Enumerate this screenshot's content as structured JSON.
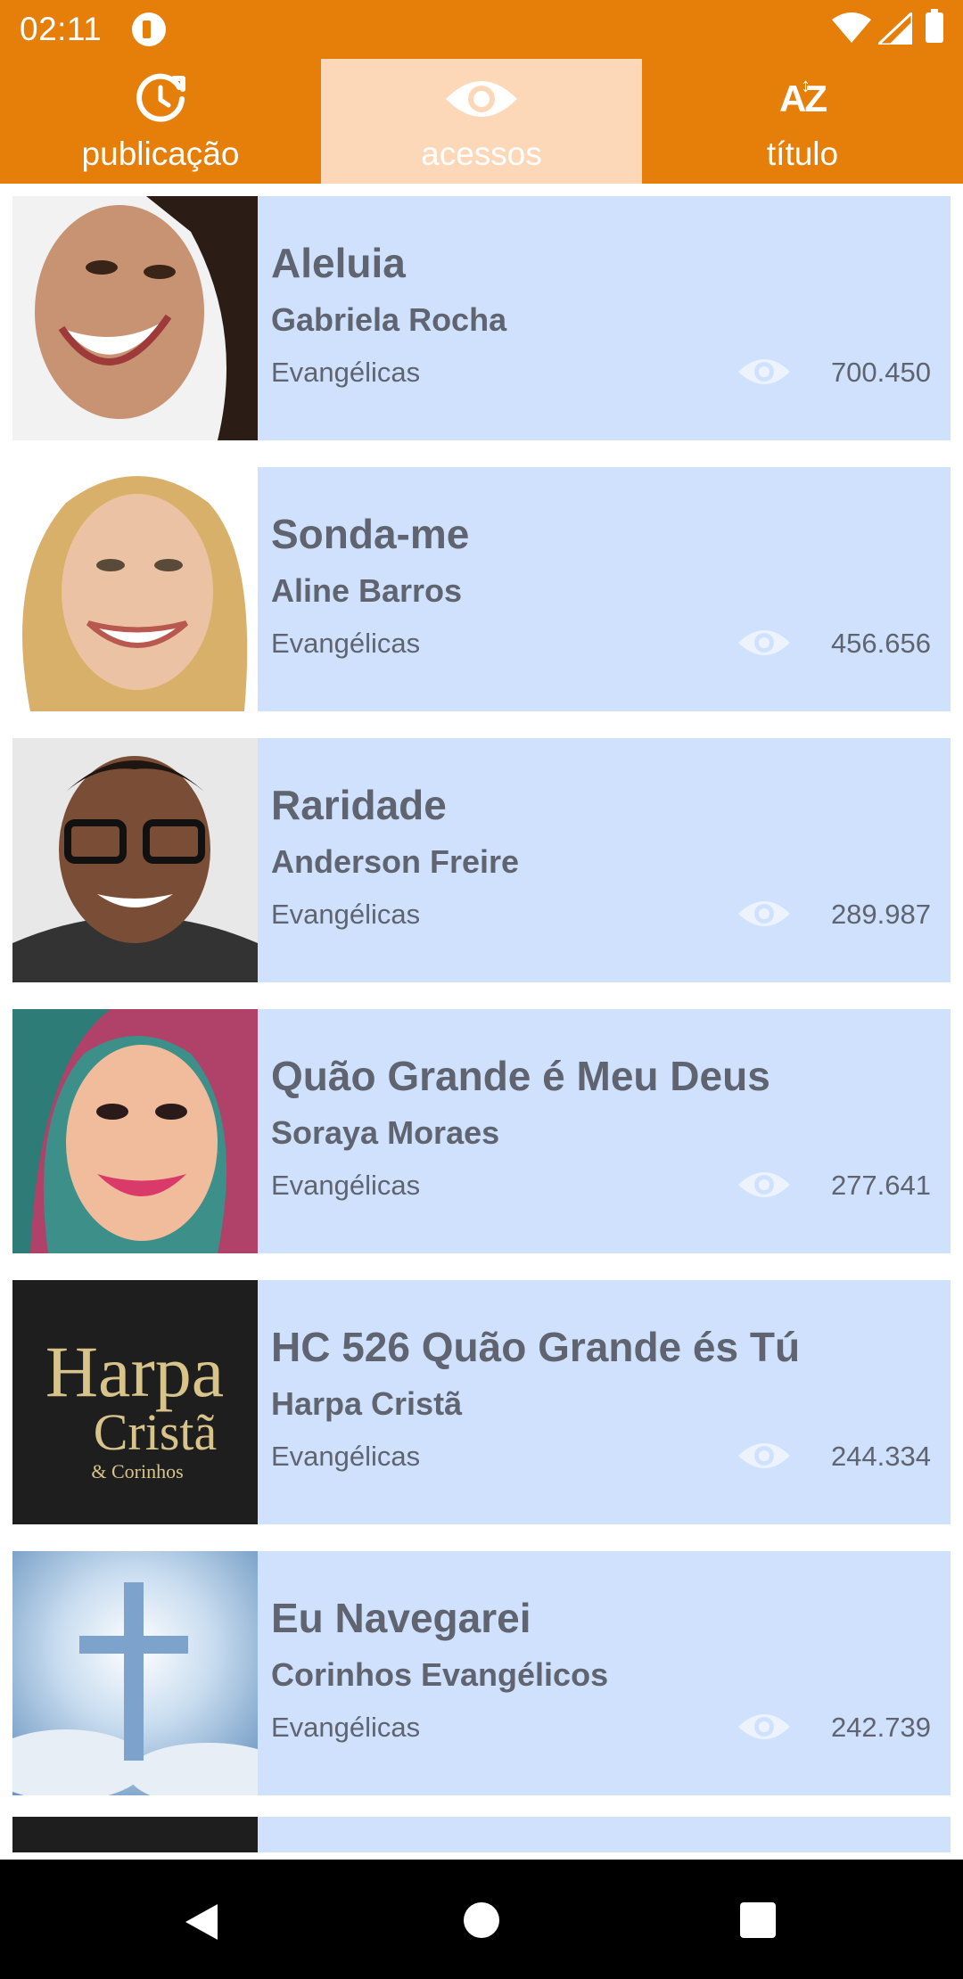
{
  "status_bar": {
    "time": "02:11",
    "icons": [
      "app-notification-icon",
      "wifi-icon",
      "signal-icon",
      "battery-icon"
    ]
  },
  "tabs": [
    {
      "label": "publicação",
      "icon": "history-icon",
      "active": false
    },
    {
      "label": "acessos",
      "icon": "eye-icon",
      "active": true
    },
    {
      "label": "título",
      "icon": "sort-alpha-icon",
      "active": false
    }
  ],
  "songs": [
    {
      "title": "Aleluia",
      "artist": "Gabriela Rocha",
      "category": "Evangélicas",
      "views": "700.450"
    },
    {
      "title": "Sonda-me",
      "artist": "Aline Barros",
      "category": "Evangélicas",
      "views": "456.656"
    },
    {
      "title": "Raridade",
      "artist": "Anderson Freire",
      "category": "Evangélicas",
      "views": "289.987"
    },
    {
      "title": "Quão Grande é Meu Deus",
      "artist": "Soraya Moraes",
      "category": "Evangélicas",
      "views": "277.641"
    },
    {
      "title": "HC 526 Quão Grande és Tú",
      "artist": "Harpa Cristã",
      "category": "Evangélicas",
      "views": "244.334"
    },
    {
      "title": "Eu Navegarei",
      "artist": "Corinhos Evangélicos",
      "category": "Evangélicas",
      "views": "242.739"
    }
  ],
  "thumb_text": {
    "harpa_line1": "Harpa",
    "harpa_line2": "Cristã",
    "harpa_line3": "& Corinhos"
  },
  "nav_bar": {
    "icons": [
      "back-icon",
      "home-icon",
      "recents-icon"
    ]
  },
  "colors": {
    "header": "#E67E0A",
    "active_tab": "#FCD8B9",
    "card_background": "#CFE1FC",
    "card_text": "#5F6470"
  }
}
